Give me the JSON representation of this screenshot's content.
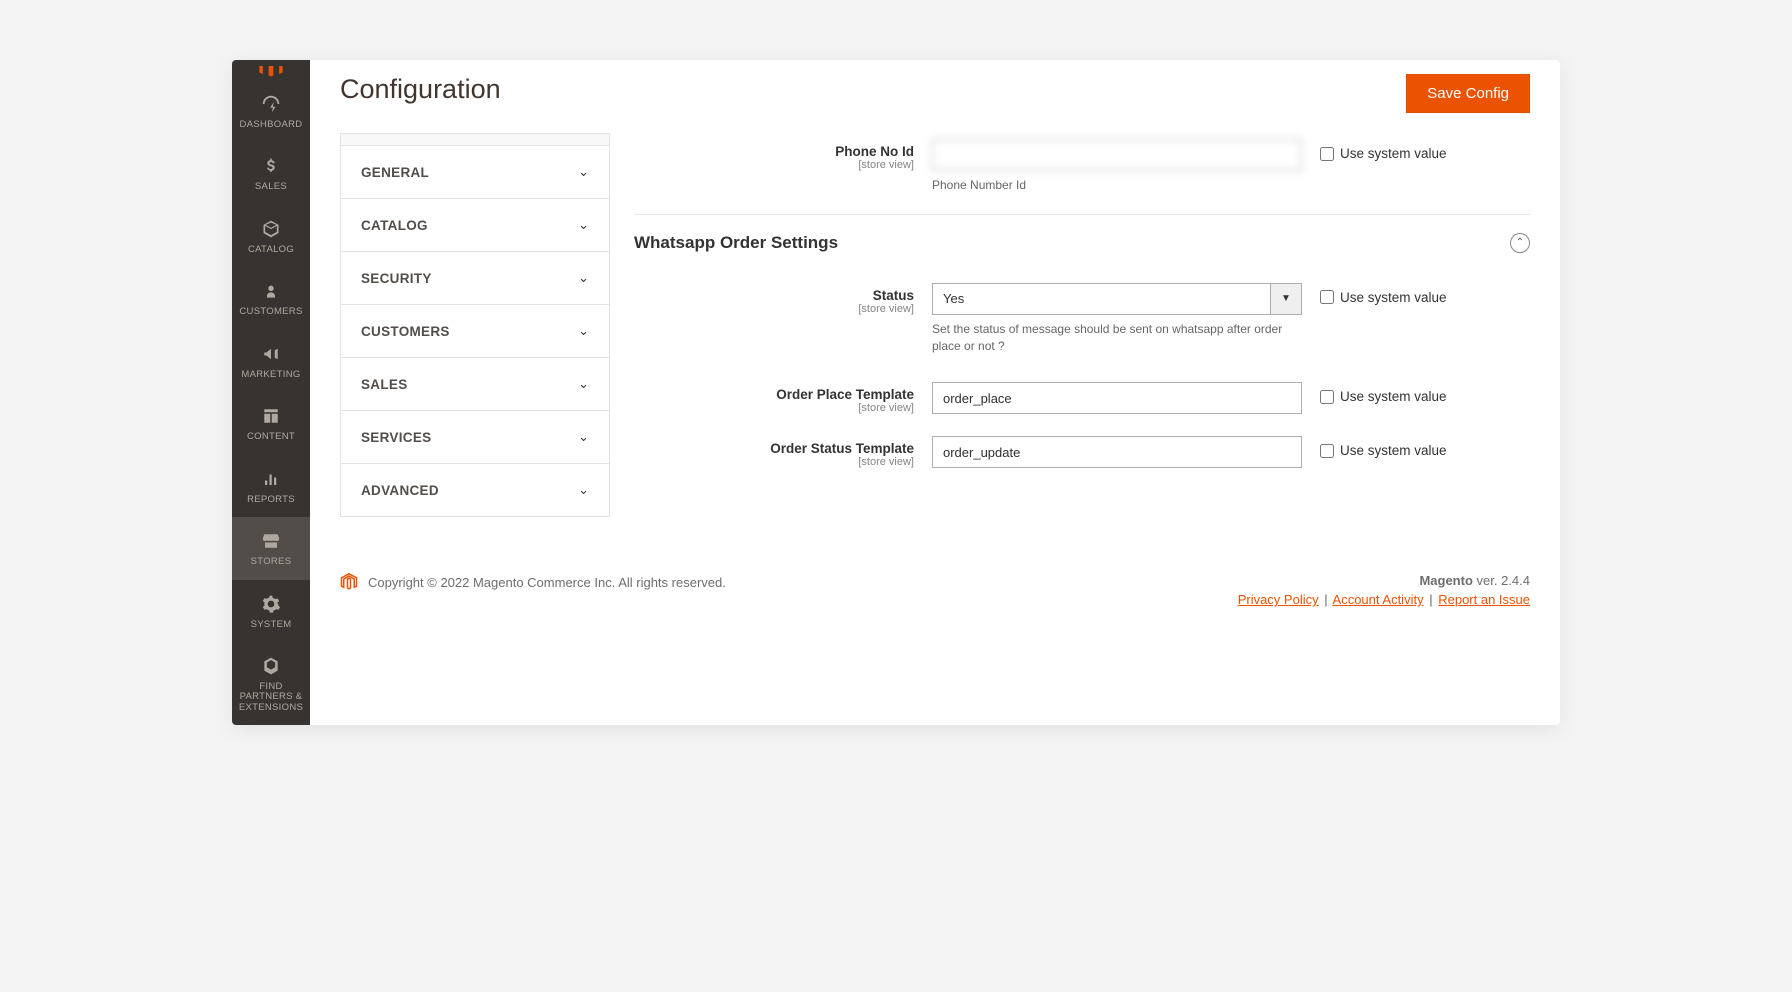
{
  "header": {
    "title": "Configuration",
    "save_button": "Save Config"
  },
  "sidebar": {
    "items": [
      {
        "label": "DASHBOARD"
      },
      {
        "label": "SALES"
      },
      {
        "label": "CATALOG"
      },
      {
        "label": "CUSTOMERS"
      },
      {
        "label": "MARKETING"
      },
      {
        "label": "CONTENT"
      },
      {
        "label": "REPORTS"
      },
      {
        "label": "STORES"
      },
      {
        "label": "SYSTEM"
      },
      {
        "label": "FIND PARTNERS & EXTENSIONS"
      }
    ]
  },
  "tabs": [
    {
      "label": "GENERAL"
    },
    {
      "label": "CATALOG"
    },
    {
      "label": "SECURITY"
    },
    {
      "label": "CUSTOMERS"
    },
    {
      "label": "SALES"
    },
    {
      "label": "SERVICES"
    },
    {
      "label": "ADVANCED"
    }
  ],
  "fields": {
    "phone_no_id": {
      "label": "Phone No Id",
      "scope": "[store view]",
      "value": "",
      "help": "Phone Number Id",
      "use_system": "Use system value"
    },
    "section_title": "Whatsapp Order Settings",
    "status": {
      "label": "Status",
      "scope": "[store view]",
      "value": "Yes",
      "help": "Set the status of message should be sent on whatsapp after order place or not ?",
      "use_system": "Use system value"
    },
    "order_place_template": {
      "label": "Order Place Template",
      "scope": "[store view]",
      "value": "order_place",
      "use_system": "Use system value"
    },
    "order_status_template": {
      "label": "Order Status Template",
      "scope": "[store view]",
      "value": "order_update",
      "use_system": "Use system value"
    }
  },
  "footer": {
    "copyright": "Copyright © 2022 Magento Commerce Inc. All rights reserved.",
    "name": "Magento",
    "version": " ver. 2.4.4",
    "links": {
      "privacy": "Privacy Policy",
      "activity": " Account Activity",
      "report": "Report an Issue"
    }
  }
}
